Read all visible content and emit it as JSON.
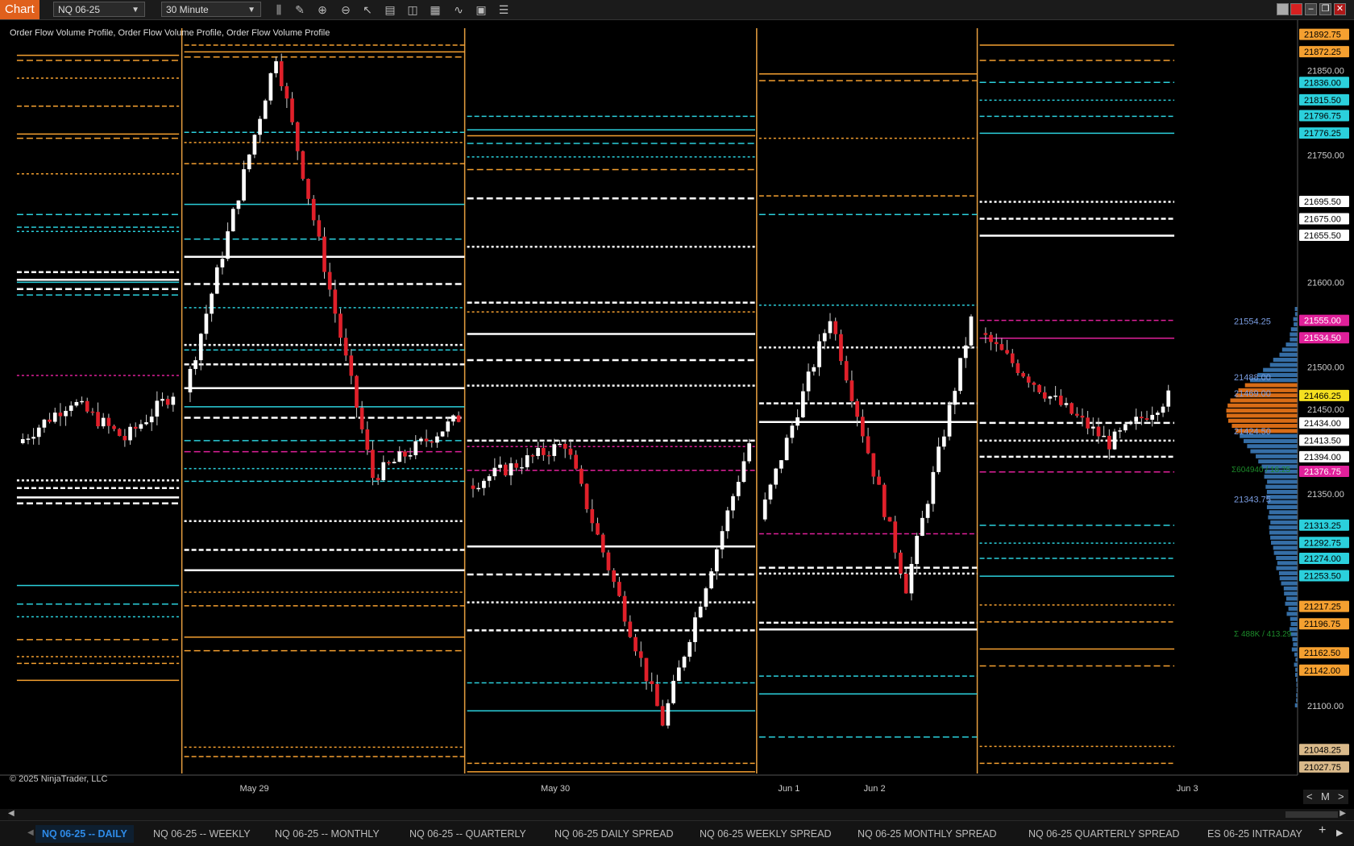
{
  "window": {
    "app_label": "Chart",
    "instrument": "NQ 06-25",
    "interval": "30 Minute",
    "indicator_label": "Order Flow Volume Profile, Order Flow Volume Profile, Order Flow Volume Profile",
    "copyright": "© 2025 NinjaTrader, LLC"
  },
  "colors": {
    "background": "#000000",
    "up_candle": "#ffffff",
    "down_candle": "#e0202a",
    "orange": "#f5a030",
    "cyan": "#2bd0dc",
    "magenta": "#e0209a",
    "white_line": "#ffffff",
    "accent_tab": "#2e8be8"
  },
  "toolbar_icons": [
    "bar-type-icon",
    "pencil-icon",
    "zoom-in-icon",
    "zoom-out-icon",
    "pointer-icon",
    "properties-icon",
    "templates-icon",
    "strategy-icon",
    "indicator-icon",
    "data-box-icon",
    "list-icon"
  ],
  "chart_data": {
    "type": "candlestick",
    "ylim": [
      21020,
      21900
    ],
    "x_labels": [
      {
        "label": "May 29",
        "pos": 0.196
      },
      {
        "label": "May 30",
        "pos": 0.428
      },
      {
        "label": "Jun 1",
        "pos": 0.608
      },
      {
        "label": "Jun 2",
        "pos": 0.674
      },
      {
        "label": "Jun 3",
        "pos": 0.915
      }
    ],
    "y_ticks": [
      21850,
      21750,
      21600,
      21500,
      21450,
      21350,
      21100
    ],
    "price_markers": [
      {
        "value": 21892.75,
        "label": "21892.75",
        "bg": "#f5a030",
        "fg": "#000000"
      },
      {
        "value": 21872.25,
        "label": "21872.25",
        "bg": "#f5a030",
        "fg": "#000000"
      },
      {
        "value": 21836.0,
        "label": "21836.00",
        "bg": "#2bd0dc",
        "fg": "#000000"
      },
      {
        "value": 21815.5,
        "label": "21815.50",
        "bg": "#2bd0dc",
        "fg": "#000000"
      },
      {
        "value": 21796.75,
        "label": "21796.75",
        "bg": "#2bd0dc",
        "fg": "#000000"
      },
      {
        "value": 21776.25,
        "label": "21776.25",
        "bg": "#2bd0dc",
        "fg": "#000000"
      },
      {
        "value": 21695.5,
        "label": "21695.50",
        "bg": "#ffffff",
        "fg": "#000000"
      },
      {
        "value": 21675.0,
        "label": "21675.00",
        "bg": "#ffffff",
        "fg": "#000000"
      },
      {
        "value": 21655.5,
        "label": "21655.50",
        "bg": "#ffffff",
        "fg": "#000000"
      },
      {
        "value": 21555.0,
        "label": "21555.00",
        "bg": "#e0209a",
        "fg": "#ffffff"
      },
      {
        "value": 21534.5,
        "label": "21534.50",
        "bg": "#e0209a",
        "fg": "#ffffff"
      },
      {
        "value": 21466.25,
        "label": "21466.25",
        "bg": "#f5e020",
        "fg": "#000000"
      },
      {
        "value": 21434.0,
        "label": "21434.00",
        "bg": "#ffffff",
        "fg": "#000000"
      },
      {
        "value": 21413.5,
        "label": "21413.50",
        "bg": "#ffffff",
        "fg": "#000000"
      },
      {
        "value": 21394.0,
        "label": "21394.00",
        "bg": "#ffffff",
        "fg": "#000000"
      },
      {
        "value": 21376.75,
        "label": "21376.75",
        "bg": "#e0209a",
        "fg": "#ffffff"
      },
      {
        "value": 21313.25,
        "label": "21313.25",
        "bg": "#2bd0dc",
        "fg": "#000000"
      },
      {
        "value": 21292.75,
        "label": "21292.75",
        "bg": "#2bd0dc",
        "fg": "#000000"
      },
      {
        "value": 21274.0,
        "label": "21274.00",
        "bg": "#2bd0dc",
        "fg": "#000000"
      },
      {
        "value": 21253.5,
        "label": "21253.50",
        "bg": "#2bd0dc",
        "fg": "#000000"
      },
      {
        "value": 21217.25,
        "label": "21217.25",
        "bg": "#f5a030",
        "fg": "#000000"
      },
      {
        "value": 21196.75,
        "label": "21196.75",
        "bg": "#f5a030",
        "fg": "#000000"
      },
      {
        "value": 21162.5,
        "label": "21162.50",
        "bg": "#f5a030",
        "fg": "#000000"
      },
      {
        "value": 21142.0,
        "label": "21142.00",
        "bg": "#f5a030",
        "fg": "#000000"
      },
      {
        "value": 21048.25,
        "label": "21048.25",
        "bg": "#d9b98a",
        "fg": "#000000"
      },
      {
        "value": 21027.75,
        "label": "21027.75",
        "bg": "#d9b98a",
        "fg": "#000000"
      }
    ],
    "profile_labels": [
      {
        "value": 21554.25,
        "label": "21554.25"
      },
      {
        "value": 21488.0,
        "label": "21488.00"
      },
      {
        "value": 21469.0,
        "label": "21469.00"
      },
      {
        "value": 21424.5,
        "label": "21424.50"
      },
      {
        "value": 21343.75,
        "label": "21343.75"
      }
    ],
    "profile_stats": [
      "Σ 488K / 413.29",
      "Σ604940 / 16.25"
    ],
    "segments": [
      {
        "x": [
          0.013,
          0.138
        ],
        "o": 21410,
        "c": 21470,
        "h": 21470,
        "l": 21405
      },
      {
        "x": [
          0.142,
          0.358
        ],
        "o": 21470,
        "c": 21440,
        "h": 21878,
        "l": 21360
      },
      {
        "x": [
          0.36,
          0.582
        ],
        "o": 21360,
        "c": 21410,
        "h": 21420,
        "l": 21070
      },
      {
        "x": [
          0.585,
          0.753
        ],
        "o": 21320,
        "c": 21555,
        "h": 21570,
        "l": 21230
      },
      {
        "x": [
          0.755,
          0.905
        ],
        "o": 21540,
        "c": 21465,
        "h": 21545,
        "l": 21400
      }
    ],
    "levels": [
      {
        "x": [
          0.013,
          0.138
        ],
        "values": [
          21868,
          21862,
          21841,
          21808,
          21775,
          21770,
          21728
        ],
        "color": "orange"
      },
      {
        "x": [
          0.013,
          0.138
        ],
        "values": [
          21680,
          21660,
          21665,
          21600,
          21585
        ],
        "color": "cyan"
      },
      {
        "x": [
          0.013,
          0.138
        ],
        "values": [
          21490
        ],
        "color": "magenta"
      },
      {
        "x": [
          0.013,
          0.138
        ],
        "values": [
          21612,
          21603,
          21592,
          21366,
          21357,
          21346,
          21339
        ],
        "color": "white"
      },
      {
        "x": [
          0.013,
          0.138
        ],
        "values": [
          21242,
          21220,
          21205
        ],
        "color": "cyan"
      },
      {
        "x": [
          0.013,
          0.138
        ],
        "values": [
          21178,
          21158,
          21150,
          21130
        ],
        "color": "orange"
      },
      {
        "x": [
          0.142,
          0.358
        ],
        "values": [
          21912,
          21880,
          21872,
          21866,
          21765,
          21740
        ],
        "color": "orange"
      },
      {
        "x": [
          0.142,
          0.358
        ],
        "values": [
          21777,
          21692,
          21651,
          21570,
          21520,
          21453,
          21413,
          21380,
          21365
        ],
        "color": "cyan"
      },
      {
        "x": [
          0.142,
          0.358
        ],
        "values": [
          21630,
          21598,
          21526,
          21503,
          21475,
          21440,
          21318,
          21284,
          21260
        ],
        "color": "white"
      },
      {
        "x": [
          0.142,
          0.358
        ],
        "values": [
          21400
        ],
        "color": "magenta"
      },
      {
        "x": [
          0.142,
          0.358
        ],
        "values": [
          21234,
          21218,
          21181,
          21165,
          21051,
          21040
        ],
        "color": "orange"
      },
      {
        "x": [
          0.36,
          0.582
        ],
        "values": [
          21796,
          21780,
          21764,
          21748
        ],
        "color": "cyan"
      },
      {
        "x": [
          0.36,
          0.582
        ],
        "values": [
          21773,
          21733,
          21565,
          21032,
          21022
        ],
        "color": "orange"
      },
      {
        "x": [
          0.36,
          0.582
        ],
        "values": [
          21699,
          21642,
          21576,
          21539,
          21508,
          21478,
          21413,
          21288,
          21255,
          21222,
          21189
        ],
        "color": "white"
      },
      {
        "x": [
          0.36,
          0.582
        ],
        "values": [
          21406,
          21378
        ],
        "color": "magenta"
      },
      {
        "x": [
          0.36,
          0.582
        ],
        "values": [
          21127,
          21094
        ],
        "color": "cyan"
      },
      {
        "x": [
          0.585,
          0.753
        ],
        "values": [
          21846,
          21838,
          21770,
          21702
        ],
        "color": "orange"
      },
      {
        "x": [
          0.585,
          0.753
        ],
        "values": [
          21680,
          21573,
          21135,
          21114,
          21063
        ],
        "color": "cyan"
      },
      {
        "x": [
          0.585,
          0.753
        ],
        "values": [
          21523,
          21457,
          21435,
          21263,
          21256,
          21198,
          21190
        ],
        "color": "white"
      },
      {
        "x": [
          0.585,
          0.753
        ],
        "values": [
          21303
        ],
        "color": "magenta"
      },
      {
        "x": [
          0.755,
          0.905
        ],
        "values": [
          21880,
          21862,
          21219,
          21199,
          21167,
          21147,
          21052,
          21032
        ],
        "color": "orange"
      },
      {
        "x": [
          0.755,
          0.905
        ],
        "values": [
          21836,
          21815,
          21796,
          21776,
          21313,
          21292,
          21274,
          21253
        ],
        "color": "cyan"
      },
      {
        "x": [
          0.755,
          0.905
        ],
        "values": [
          21695,
          21675,
          21655,
          21434,
          21413,
          21394
        ],
        "color": "white"
      },
      {
        "x": [
          0.755,
          0.905
        ],
        "values": [
          21555,
          21534,
          21376
        ],
        "color": "magenta"
      }
    ]
  },
  "bottom": {
    "tabs": [
      "NQ 06-25 -- DAILY",
      "NQ 06-25 -- WEEKLY",
      "NQ 06-25 -- MONTHLY",
      "NQ 06-25 -- QUARTERLY",
      "NQ 06-25 DAILY SPREAD",
      "NQ 06-25 WEEKLY SPREAD",
      "NQ 06-25 MONTHLY SPREAD",
      "NQ 06-25 QUARTERLY SPREAD",
      "ES 06-25 INTRADAY"
    ],
    "active_tab": 0,
    "add_tab": "+",
    "zoom_label": "M"
  }
}
